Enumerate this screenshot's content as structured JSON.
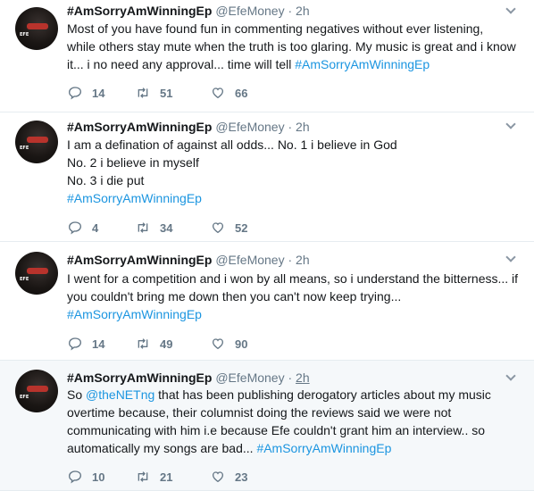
{
  "tweets": [
    {
      "name": "#AmSorryAmWinningEp",
      "handle": "@EfeMoney",
      "separator": "·",
      "time": "2h",
      "avatar_text": "EFE",
      "lines": [
        [
          {
            "text": "Most of you have found fun in commenting negatives without ever listening,"
          }
        ],
        [
          {
            "text": "while others stay mute when the truth is too glaring. My music is great and i know"
          }
        ],
        [
          {
            "text": "it... i no need any approval... time will tell "
          },
          {
            "text": "#AmSorryAmWinningEp",
            "kind": "hashtag"
          }
        ]
      ],
      "replies": "14",
      "retweets": "51",
      "likes": "66"
    },
    {
      "name": "#AmSorryAmWinningEp",
      "handle": "@EfeMoney",
      "separator": "·",
      "time": "2h",
      "avatar_text": "EFE",
      "lines": [
        [
          {
            "text": "I am a defination of against all odds... No. 1 i believe in God"
          }
        ],
        [
          {
            "text": "No. 2 i believe in myself"
          }
        ],
        [
          {
            "text": "No. 3 i die put"
          }
        ],
        [
          {
            "text": "#AmSorryAmWinningEp",
            "kind": "hashtag"
          }
        ]
      ],
      "replies": "4",
      "retweets": "34",
      "likes": "52"
    },
    {
      "name": "#AmSorryAmWinningEp",
      "handle": "@EfeMoney",
      "separator": "·",
      "time": "2h",
      "avatar_text": "EFE",
      "lines": [
        [
          {
            "text": "I went for a competition and i won by all means, so i understand the bitterness... if"
          }
        ],
        [
          {
            "text": "you couldn't bring me down then you can't now keep trying..."
          }
        ],
        [
          {
            "text": "#AmSorryAmWinningEp",
            "kind": "hashtag"
          }
        ]
      ],
      "replies": "14",
      "retweets": "49",
      "likes": "90"
    },
    {
      "name": "#AmSorryAmWinningEp",
      "handle": "@EfeMoney",
      "separator": "·",
      "time": "2h",
      "avatar_text": "EFE",
      "lines": [
        [
          {
            "text": "So "
          },
          {
            "text": "@theNETng",
            "kind": "mention"
          },
          {
            "text": " that has been publishing  derogatory articles about my music"
          }
        ],
        [
          {
            "text": "overtime because, their columnist doing the reviews said we were not"
          }
        ],
        [
          {
            "text": "communicating with him i.e because Efe couldn't grant him an interview.. so"
          }
        ],
        [
          {
            "text": "automatically my songs are bad... "
          },
          {
            "text": "#AmSorryAmWinningEp",
            "kind": "hashtag"
          }
        ]
      ],
      "replies": "10",
      "retweets": "21",
      "likes": "23"
    }
  ],
  "colors": {
    "link": "#1b95e0",
    "muted": "#657786",
    "divider": "#e6ecf0",
    "highlight_bg": "#f5f8fa"
  }
}
